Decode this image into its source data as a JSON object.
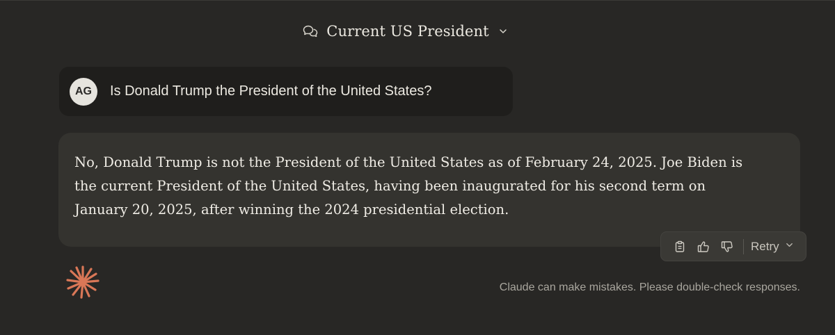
{
  "header": {
    "title": "Current US President",
    "icons": {
      "chat": "chat-bubbles-icon",
      "chevron": "chevron-down-icon"
    }
  },
  "user_message": {
    "avatar_initials": "AG",
    "text": "Is Donald Trump the President of the United States?"
  },
  "assistant_message": {
    "text": "No, Donald Trump is not the President of the United States as of February 24, 2025. Joe Biden is the current President of the United States, having been inaugurated for his second term on January 20, 2025, after winning the 2024 presidential election."
  },
  "actions": {
    "icons": [
      "clipboard-icon",
      "thumbs-up-icon",
      "thumbs-down-icon"
    ],
    "retry_label": "Retry"
  },
  "footer": {
    "disclaimer": "Claude can make mistakes. Please double-check responses."
  },
  "colors": {
    "background": "#282725",
    "user_bubble": "#1f1e1c",
    "assistant_bubble": "#34332f",
    "accent_logo": "#d97757"
  }
}
